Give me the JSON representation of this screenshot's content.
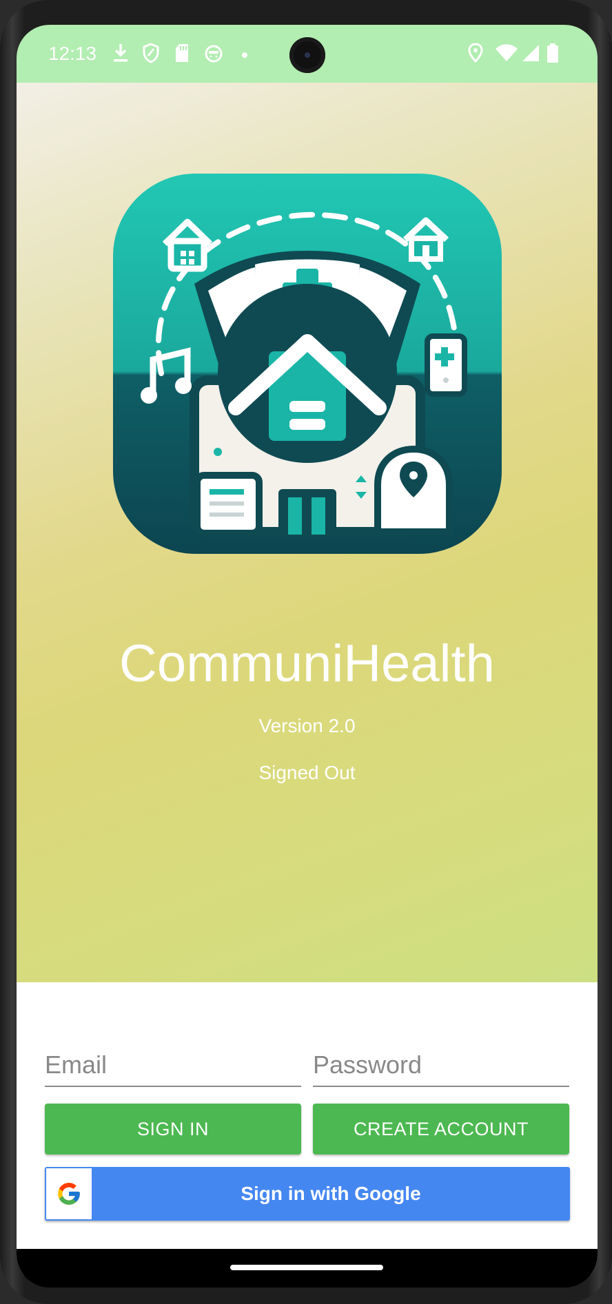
{
  "status_bar": {
    "time": "12:13",
    "left_icons": [
      "download-icon",
      "shield-icon",
      "sd-card-icon",
      "android-face-icon",
      "dot-icon"
    ],
    "right_icons": [
      "location-icon",
      "wifi-icon",
      "cell-signal-icon",
      "battery-icon"
    ]
  },
  "hero": {
    "logo_name": "communihealth-logo",
    "app_name": "CommuniHealth",
    "version": "Version 2.0",
    "signed_status": "Signed Out"
  },
  "auth": {
    "email_placeholder": "Email",
    "email_value": "",
    "password_placeholder": "Password",
    "password_value": "",
    "sign_in_label": "SIGN IN",
    "create_account_label": "CREATE ACCOUNT",
    "google_label": "Sign in with Google"
  },
  "colors": {
    "status_bar": "#b2edb1",
    "primary_green": "#4cb851",
    "google_blue": "#4587f1",
    "logo_teal": "#1fbfae",
    "logo_dark": "#0f4a52"
  }
}
